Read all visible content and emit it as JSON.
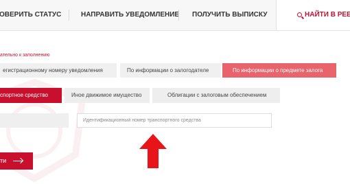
{
  "nav": {
    "items": [
      {
        "label": "ОВЕРИТЬ СТАТУС"
      },
      {
        "label": "НАПРАВИТЬ УВЕДОМЛЕНИЕ"
      },
      {
        "label": "ПОЛУЧИТЬ ВЫПИСКУ"
      },
      {
        "label": "НАЙТИ В РЕЕСТ",
        "icon": "search-icon",
        "active": true
      }
    ]
  },
  "form": {
    "required_note": "ательно к заполнению",
    "search_tabs": [
      {
        "label": "егистрационному номеру уведомления"
      },
      {
        "label": "По информации о залогодателе"
      },
      {
        "label": "По информации о предмете залога",
        "selected": true
      }
    ],
    "property_tabs": [
      {
        "label": "спортное средство",
        "selected": true
      },
      {
        "label": "Иное движимое имущество"
      },
      {
        "label": "Облигации с залоговым обеспечением"
      }
    ],
    "vin_input": {
      "placeholder": "Идентификационный номер транспортного средства",
      "value": ""
    },
    "search_button": {
      "label": "ти",
      "icon": "arrow-right-icon"
    }
  },
  "colors": {
    "accent": "#c8102e",
    "tab_selected": "#e8636b",
    "annotation_arrow": "#e8141a"
  }
}
